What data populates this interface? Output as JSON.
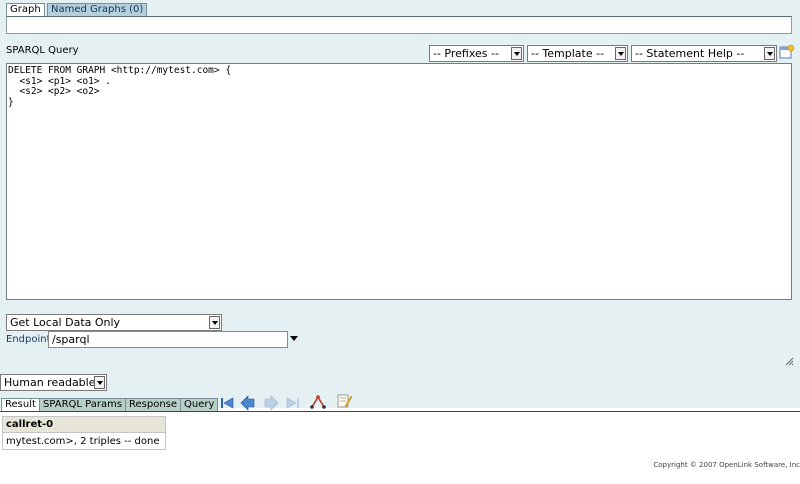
{
  "tabs_top": {
    "graph": "Graph",
    "named_graphs": "Named Graphs (0)"
  },
  "query": {
    "label": "SPARQL Query",
    "prefixes": "-- Prefixes --",
    "template": "-- Template --",
    "statement_help": "-- Statement Help --",
    "text": "DELETE FROM GRAPH <http://mytest.com> {\n  <s1> <p1> <o1> .\n  <s2> <p2> <o2>\n}"
  },
  "data_source": {
    "selected": "Get Local Data Only"
  },
  "endpoint": {
    "label": "Endpoint",
    "value": "/sparql"
  },
  "format": {
    "selected": "Human readable"
  },
  "tabs_bottom": {
    "result": "Result",
    "sparql_params": "SPARQL Params",
    "response": "Response",
    "query": "Query"
  },
  "results": {
    "header": "callret-0",
    "row": "mytest.com>, 2 triples -- done"
  },
  "footer": {
    "copyright": "Copyright © 2007 OpenLink Software, Inc"
  },
  "colors": {
    "panel_bg": "#e5f0f2",
    "active_tab": "#b3d0dc",
    "nav_blue": "#2a63b8",
    "result_header": "#e6e5d7"
  }
}
